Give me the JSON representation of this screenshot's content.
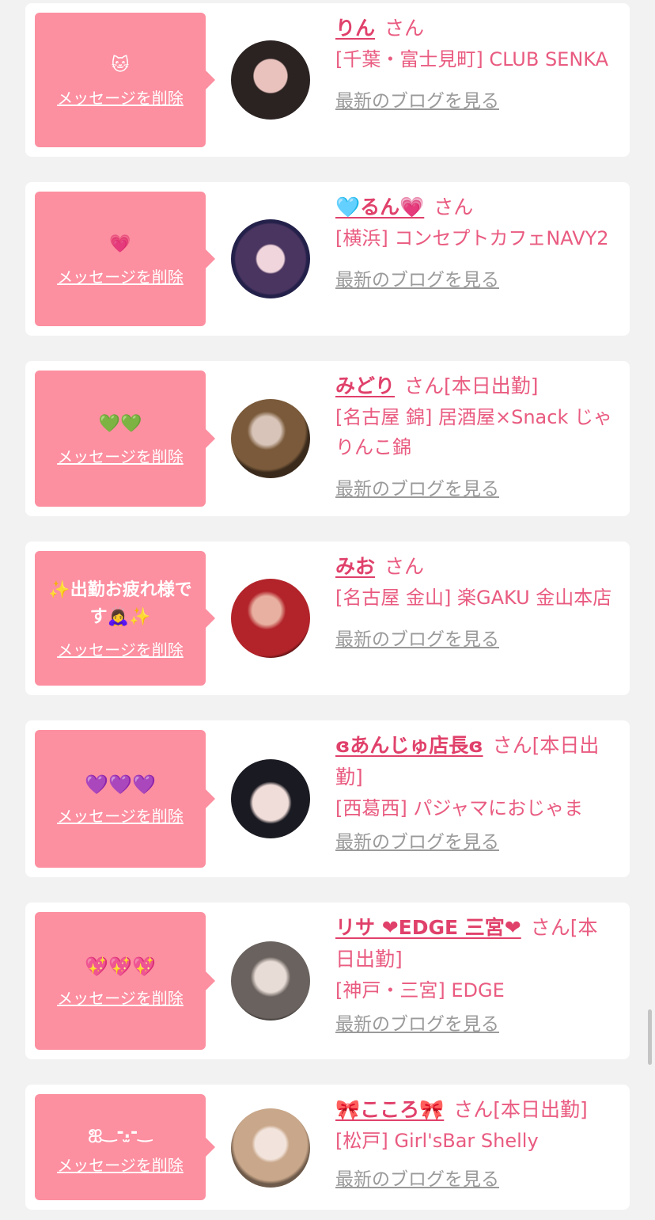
{
  "delete_label": "メッセージを削除",
  "blog_label": "最新のブログを見る",
  "san_label": "さん",
  "cards": [
    {
      "message": "🐱",
      "name": "りん",
      "suffix": "",
      "shop": "[千葉・富士見町] CLUB SENKA"
    },
    {
      "message": "💗",
      "name": "🩵るん💗",
      "suffix": "",
      "shop": "[横浜] コンセプトカフェNAVY2"
    },
    {
      "message": "💚💚",
      "name": "みどり",
      "suffix": "[本日出勤]",
      "shop": "[名古屋 錦] 居酒屋×Snack じゃりんこ錦"
    },
    {
      "message": "✨出勤お疲れ様です🙇‍♀️✨",
      "name": "みお",
      "suffix": "",
      "shop": "[名古屋 金山] 楽GAKU 金山本店"
    },
    {
      "message": "💜💜💜",
      "name": "ɞあんじゅ店長ɞ",
      "suffix": "[本日出勤]",
      "shop": "[西葛西] パジャマにおじゃま"
    },
    {
      "message": "💖💖💖",
      "name": "リサ ❤EDGE 三宮❤",
      "suffix": "[本日出勤]",
      "shop": "[神戸・三宮] EDGE"
    },
    {
      "message": "ஐ‿-.̫-‿",
      "name": "🎀こころ🎀",
      "suffix": "[本日出勤]",
      "shop": "[松戸] Girl'sBar Shelly"
    }
  ],
  "colors": {
    "background": "#f2f2f2",
    "bubble": "#fc8fa0",
    "name": "#e0416b",
    "text": "#e95b80",
    "link_gray": "#9a9a9a"
  }
}
